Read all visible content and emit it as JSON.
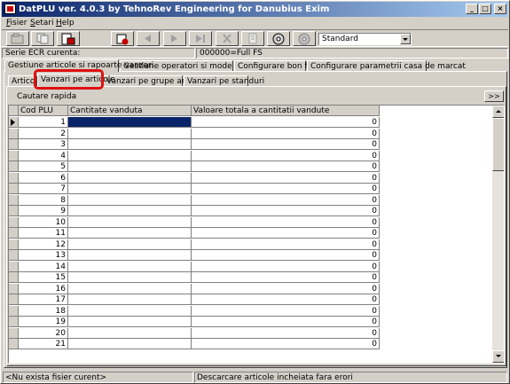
{
  "window": {
    "title": "DatPLU ver. 4.0.3 by TehnoRev Engineering for Danubius Exim",
    "minimize": "_",
    "maximize": "□",
    "close": "×"
  },
  "menu": {
    "items": [
      {
        "first": "F",
        "rest": "isier"
      },
      {
        "first": "S",
        "rest": "etari"
      },
      {
        "first": "H",
        "rest": "elp"
      }
    ]
  },
  "toolbar": {
    "buttons": [
      "open-file-icon",
      "copy-icon",
      "print-report-icon",
      "add-record-icon",
      "prev-record-icon",
      "next-record-icon",
      "last-record-icon",
      "delete-icon",
      "edit-icon",
      "disk-icon",
      "cd-icon"
    ],
    "combo_value": "Standard"
  },
  "info": {
    "ecr_label": "Serie ECR curenta:",
    "ecr_value": "000000=Full FS"
  },
  "main_tabs": [
    "Gestiune articole si rapoarte vanzari",
    "Gestiune operatori si mode de lucru",
    "Configurare bon fiscal",
    "Configurare parametrii casa de marcat"
  ],
  "sub_tabs": [
    "Articole",
    "Vanzari pe articole",
    "Vanzari pe grupe articole",
    "Vanzari pe standuri"
  ],
  "search": {
    "label": "Cautare rapida",
    "expand": ">>"
  },
  "grid": {
    "columns": [
      "Cod PLU",
      "Cantitate vanduta",
      "Valoare totala a cantitatii vandute"
    ],
    "rows": [
      {
        "plu": "1",
        "qty": "",
        "value": "0"
      },
      {
        "plu": "2",
        "qty": "",
        "value": "0"
      },
      {
        "plu": "3",
        "qty": "",
        "value": "0"
      },
      {
        "plu": "4",
        "qty": "",
        "value": "0"
      },
      {
        "plu": "5",
        "qty": "",
        "value": "0"
      },
      {
        "plu": "6",
        "qty": "",
        "value": "0"
      },
      {
        "plu": "7",
        "qty": "",
        "value": "0"
      },
      {
        "plu": "8",
        "qty": "",
        "value": "0"
      },
      {
        "plu": "9",
        "qty": "",
        "value": "0"
      },
      {
        "plu": "10",
        "qty": "",
        "value": "0"
      },
      {
        "plu": "11",
        "qty": "",
        "value": "0"
      },
      {
        "plu": "12",
        "qty": "",
        "value": "0"
      },
      {
        "plu": "13",
        "qty": "",
        "value": "0"
      },
      {
        "plu": "14",
        "qty": "",
        "value": "0"
      },
      {
        "plu": "15",
        "qty": "",
        "value": "0"
      },
      {
        "plu": "16",
        "qty": "",
        "value": "0"
      },
      {
        "plu": "17",
        "qty": "",
        "value": "0"
      },
      {
        "plu": "18",
        "qty": "",
        "value": "0"
      },
      {
        "plu": "19",
        "qty": "",
        "value": "0"
      },
      {
        "plu": "20",
        "qty": "",
        "value": "0"
      },
      {
        "plu": "21",
        "qty": "",
        "value": "0"
      }
    ]
  },
  "status": {
    "left": "<Nu exista fisier curent>",
    "right": "Descarcare articole incheiata fara erori"
  }
}
